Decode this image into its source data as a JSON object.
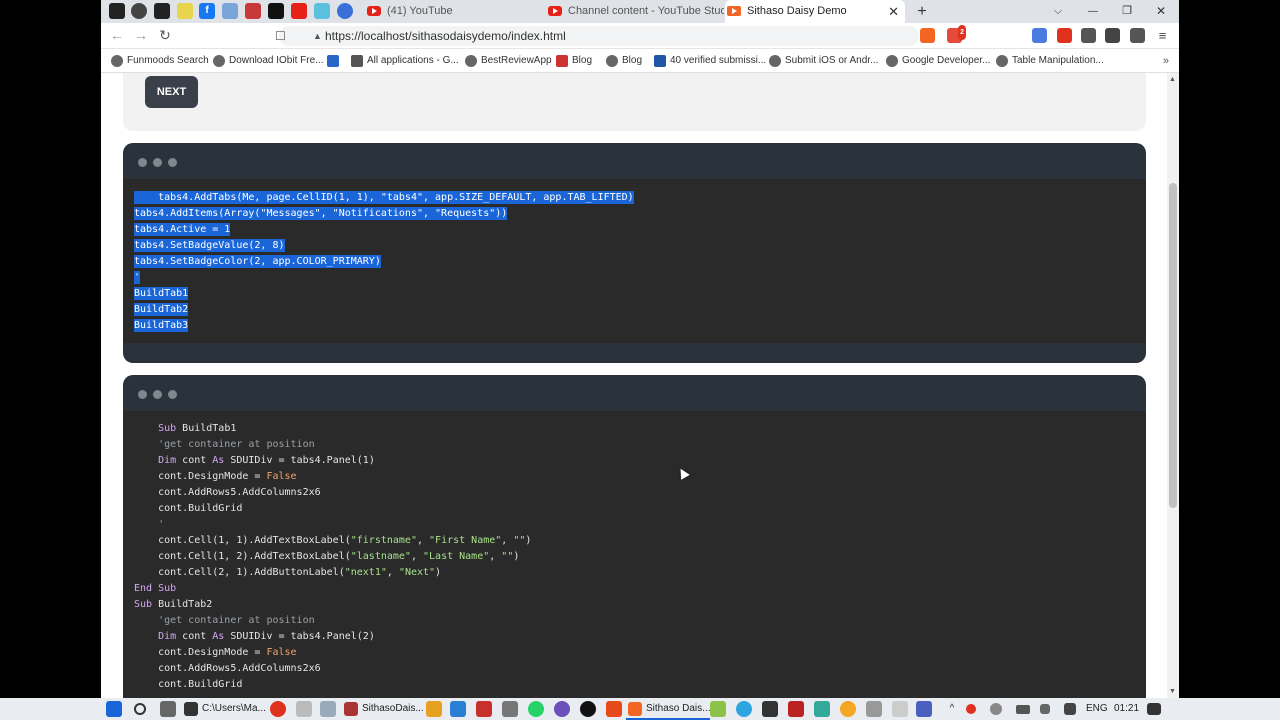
{
  "browser": {
    "tabs": [
      {
        "label": "(41) YouTube"
      },
      {
        "label": "Channel content - YouTube Studio"
      },
      {
        "label": "Sithaso Daisy Demo"
      }
    ],
    "new_tab": "+",
    "window_controls": {
      "chevron": "⌵",
      "minimize": "—",
      "restore": "❐",
      "close": "✕"
    },
    "close_tab": "✕",
    "nav": {
      "back": "←",
      "forward": "→",
      "reload": "↻"
    },
    "url": "https://localhost/sithasodaisydemo/index.html",
    "extension_badge": "2"
  },
  "bookmarks": [
    "Funmoods Search",
    "Download IObit Fre...",
    "All applications - G...",
    "BestReviewApp",
    "Blog",
    "Blog",
    "40 verified submissi...",
    "Submit iOS or Andr...",
    "Google Developer...",
    "Table Manipulation..."
  ],
  "bookmarks_more": "»",
  "page": {
    "next_label": "NEXT",
    "code_block_1": [
      "    tabs4.AddTabs(Me, page.CellID(1, 1), \"tabs4\", app.SIZE_DEFAULT, app.TAB_LIFTED)",
      "tabs4.AddItems(Array(\"Messages\", \"Notifications\", \"Requests\"))",
      "tabs4.Active = 1",
      "tabs4.SetBadgeValue(2, 8)",
      "tabs4.SetBadgeColor(2, app.COLOR_PRIMARY)",
      "'",
      "BuildTab1",
      "BuildTab2",
      "BuildTab3"
    ],
    "code_block_2": {
      "l1": {
        "a": "    ",
        "kw": "Sub",
        "b": " BuildTab1"
      },
      "l2": "    'get container at position",
      "l3": {
        "a": "    ",
        "kw1": "Dim",
        "b": " cont ",
        "kw2": "As",
        "c": " SDUIDiv = tabs4.Panel(1)"
      },
      "l4": {
        "a": "    cont.DesignMode = ",
        "fl": "False"
      },
      "l5": "    cont.AddRows5.AddColumns2x6",
      "l6": "    cont.BuildGrid",
      "l7": "    '",
      "l8": {
        "a": "    cont.Cell(1, 1).AddTextBoxLabel(",
        "s1": "\"firstname\"",
        "b": ", ",
        "s2": "\"First Name\"",
        "c": ", ",
        "s3": "\"\"",
        "d": ")"
      },
      "l9": {
        "a": "    cont.Cell(1, 2).AddTextBoxLabel(",
        "s1": "\"lastname\"",
        "b": ", ",
        "s2": "\"Last Name\"",
        "c": ", ",
        "s3": "\"\"",
        "d": ")"
      },
      "l10": {
        "a": "    cont.Cell(2, 1).AddButtonLabel(",
        "s1": "\"next1\"",
        "b": ", ",
        "s2": "\"Next\"",
        "d": ")"
      },
      "l11": {
        "kw1": "End",
        "b": " ",
        "kw2": "Sub"
      },
      "l12": {
        "kw": "Sub",
        "b": " BuildTab2"
      },
      "l13": "    'get container at position",
      "l14": {
        "a": "    ",
        "kw1": "Dim",
        "b": " cont ",
        "kw2": "As",
        "c": " SDUIDiv = tabs4.Panel(2)"
      },
      "l15": {
        "a": "    cont.DesignMode = ",
        "fl": "False"
      },
      "l16": "    cont.AddRows5.AddColumns2x6",
      "l17": "    cont.BuildGrid"
    }
  },
  "taskbar": {
    "items": [
      {
        "label": "C:\\Users\\Ma..."
      },
      {
        "label": "SithasoDais..."
      },
      {
        "label": "Sithaso Dais..."
      }
    ],
    "lang": "ENG",
    "time": "01:21"
  },
  "colors": {
    "selection": "#1a66d9",
    "code_bg": "#2a2a2a",
    "mockup_header": "#2a323c",
    "keyword": "#d5a6f5",
    "string": "#a8e08a",
    "comment": "#9aa0a6",
    "boolean": "#f4a26b"
  }
}
